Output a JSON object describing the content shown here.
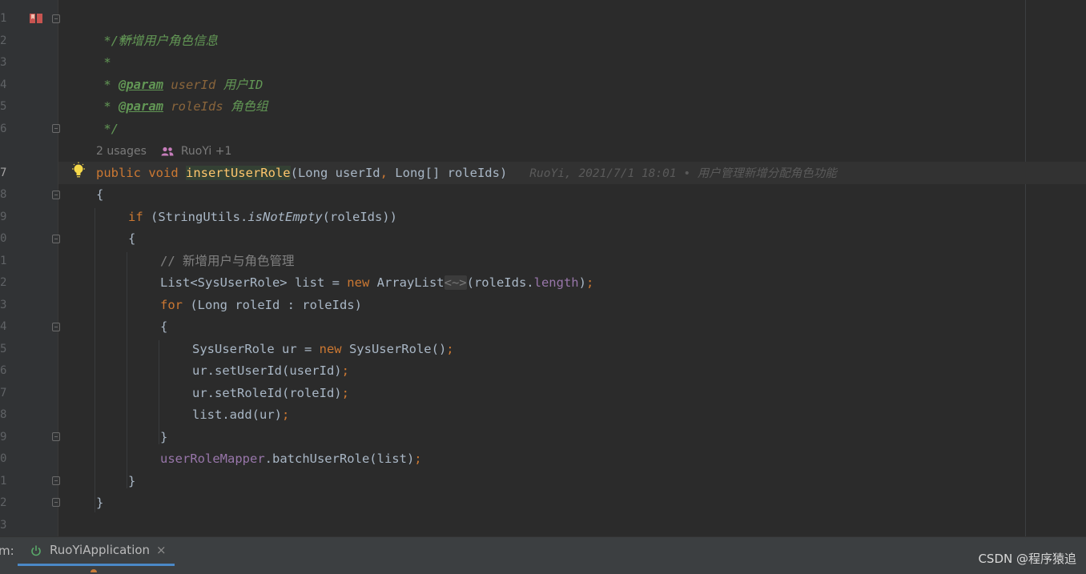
{
  "line_numbers": [
    "1",
    "2",
    "3",
    "4",
    "5",
    "6",
    "7",
    "8",
    "9",
    "0",
    "1",
    "2",
    "3",
    "4",
    "5",
    "6",
    "7",
    "8",
    "9",
    "0",
    "1",
    "2",
    "3"
  ],
  "active_line_number": "7",
  "javadoc": {
    "open": "/**",
    "desc_star": " * ",
    "desc": "新增用户角色信息",
    "blank": " *",
    "p1_star": " * ",
    "p1_tag": "@param",
    "p1_name": "userId",
    "p1_text": "用户ID",
    "p2_star": " * ",
    "p2_tag": "@param",
    "p2_name": "roleIds",
    "p2_text": "角色组",
    "close": " */"
  },
  "usages": {
    "count": "2 usages",
    "authors": "RuoYi +1"
  },
  "signature": {
    "mods": "public void ",
    "name": "insertUserRole",
    "params": "(Long userId",
    "comma": ",",
    "params2": " Long[] roleIds)",
    "blame": "RuoYi, 2021/7/1 18:01 • 用户管理新增分配角色功能"
  },
  "code": {
    "open_method": "{",
    "if_kw": "if",
    "if_a": " (StringUtils.",
    "if_call": "isNotEmpty",
    "if_b": "(roleIds))",
    "open_if": "{",
    "comment": "// 新增用户与角色管理",
    "list_a": "List<SysUserRole> list = ",
    "list_new": "new",
    "list_b": " ArrayList",
    "list_hint": "<~>",
    "list_c": "(roleIds.",
    "list_field": "length",
    "list_d": ")",
    "semi": ";",
    "for_kw": "for",
    "for_rest": " (Long roleId : roleIds)",
    "open_for": "{",
    "ur_a": "SysUserRole ur = ",
    "ur_new": "new",
    "ur_b": " SysUserRole()",
    "set_user": "ur.setUserId(userId)",
    "set_role": "ur.setRoleId(roleId)",
    "list_add": "list.add(ur)",
    "close_for": "}",
    "mapper_field": "userRoleMapper",
    "mapper_call": ".batchUserRole(list)",
    "close_if": "}",
    "close_method": "}"
  },
  "run_panel": {
    "label": "m:",
    "tab_name": "RuoYiApplication",
    "close_glyph": "×",
    "run_icon": "power-icon"
  },
  "watermark": "CSDN @程序猿追",
  "colors": {
    "editor_bg": "#2b2b2b",
    "keyword": "#cc7832",
    "method_decl": "#ffc66d",
    "javadoc": "#629755",
    "field": "#9876aa"
  }
}
